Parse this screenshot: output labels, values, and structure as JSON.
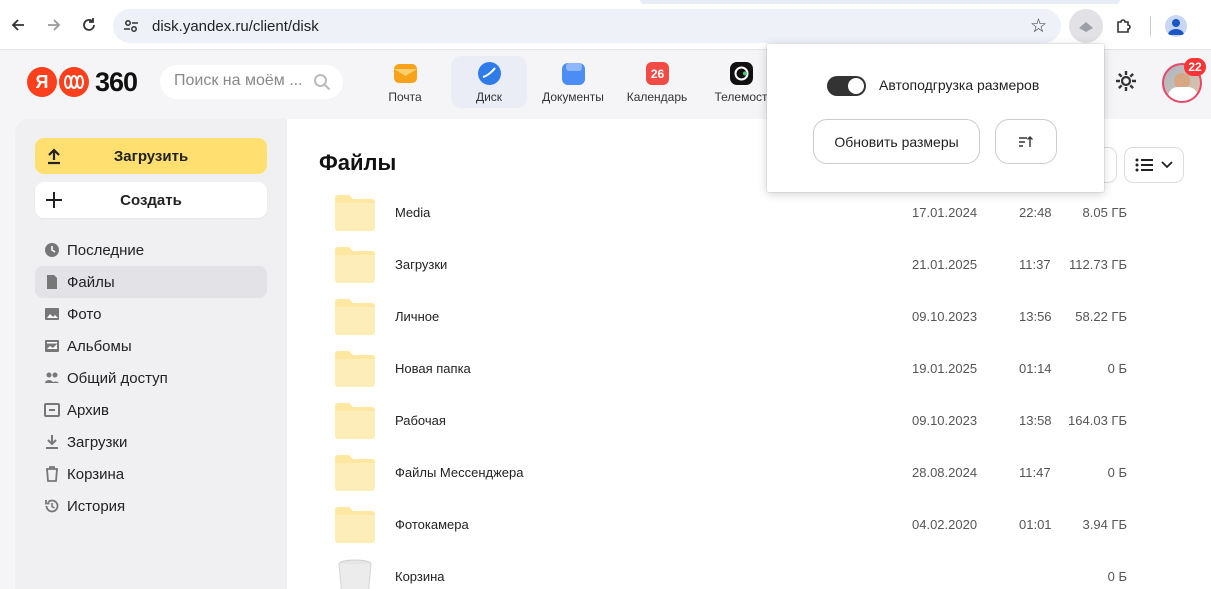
{
  "browser": {
    "url": "disk.yandex.ru/client/disk"
  },
  "header": {
    "logo_text": "360",
    "search_placeholder": "Поиск на моём ...",
    "services": [
      {
        "label": "Почта",
        "color": "#f7a21b"
      },
      {
        "label": "Диск",
        "color": "#2f7bea"
      },
      {
        "label": "Документы",
        "color": "#4b8cf5"
      },
      {
        "label": "Календарь",
        "color": "#f24a45",
        "badge": "26"
      },
      {
        "label": "Телемост",
        "color": "#111111"
      }
    ],
    "notification_count": "22"
  },
  "sidebar": {
    "upload_label": "Загрузить",
    "create_label": "Создать",
    "items": [
      {
        "label": "Последние",
        "icon": "clock-icon"
      },
      {
        "label": "Файлы",
        "icon": "file-icon",
        "active": true
      },
      {
        "label": "Фото",
        "icon": "photo-icon"
      },
      {
        "label": "Альбомы",
        "icon": "album-icon"
      },
      {
        "label": "Общий доступ",
        "icon": "people-icon"
      },
      {
        "label": "Архив",
        "icon": "archive-icon"
      },
      {
        "label": "Загрузки",
        "icon": "download-icon"
      },
      {
        "label": "Корзина",
        "icon": "trash-icon"
      },
      {
        "label": "История",
        "icon": "history-icon"
      }
    ]
  },
  "main": {
    "title": "Файлы",
    "files": [
      {
        "name": "Media",
        "date": "17.01.2024",
        "time": "22:48",
        "size": "8.05 ГБ",
        "type": "folder"
      },
      {
        "name": "Загрузки",
        "date": "21.01.2025",
        "time": "11:37",
        "size": "112.73 ГБ",
        "type": "folder"
      },
      {
        "name": "Личное",
        "date": "09.10.2023",
        "time": "13:56",
        "size": "58.22 ГБ",
        "type": "folder"
      },
      {
        "name": "Новая папка",
        "date": "19.01.2025",
        "time": "01:14",
        "size": "0 Б",
        "type": "folder"
      },
      {
        "name": "Рабочая",
        "date": "09.10.2023",
        "time": "13:58",
        "size": "164.03 ГБ",
        "type": "folder"
      },
      {
        "name": "Файлы Мессенджера",
        "date": "28.08.2024",
        "time": "11:47",
        "size": "0 Б",
        "type": "folder"
      },
      {
        "name": "Фотокамера",
        "date": "04.02.2020",
        "time": "01:01",
        "size": "3.94 ГБ",
        "type": "folder"
      },
      {
        "name": "Корзина",
        "date": "",
        "time": "",
        "size": "0 Б",
        "type": "trash"
      }
    ]
  },
  "popup": {
    "toggle_label": "Автоподгрузка размеров",
    "toggle_on": true,
    "refresh_label": "Обновить размеры"
  },
  "colors": {
    "accent_yellow": "#fedf6f",
    "folder": "#fde7a1",
    "brand_red": "#fc3f1d"
  }
}
